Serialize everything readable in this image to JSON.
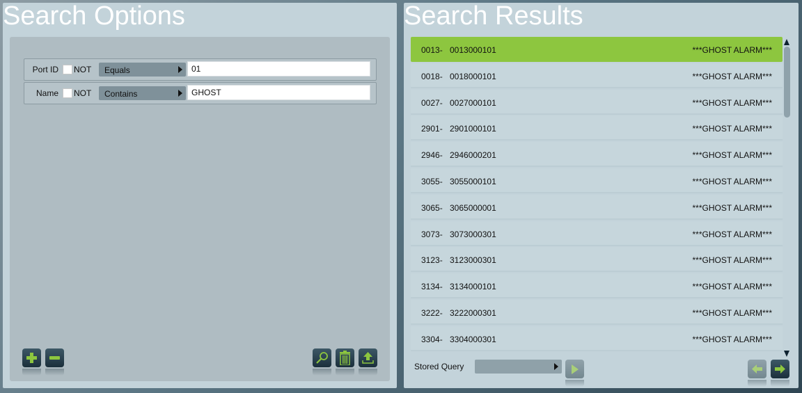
{
  "search_options": {
    "title": "Search Options",
    "criteria": [
      {
        "field": "Port ID",
        "not_label": "NOT",
        "not_checked": false,
        "operator": "Equals",
        "value": "01"
      },
      {
        "field": "Name",
        "not_label": "NOT",
        "not_checked": false,
        "operator": "Contains",
        "value": "GHOST"
      }
    ],
    "buttons": {
      "add": "add-criterion",
      "remove": "remove-criterion",
      "search": "search",
      "delete": "delete",
      "upload": "upload"
    }
  },
  "search_results": {
    "title": "Search Results",
    "selected_index": 0,
    "rows": [
      {
        "prefix": "0013-",
        "id": "0013000101",
        "name": "***GHOST ALARM***"
      },
      {
        "prefix": "0018-",
        "id": "0018000101",
        "name": "***GHOST ALARM***"
      },
      {
        "prefix": "0027-",
        "id": "0027000101",
        "name": "***GHOST ALARM***"
      },
      {
        "prefix": "2901-",
        "id": "2901000101",
        "name": "***GHOST ALARM***"
      },
      {
        "prefix": "2946-",
        "id": "2946000201",
        "name": "***GHOST ALARM***"
      },
      {
        "prefix": "3055-",
        "id": "3055000101",
        "name": "***GHOST ALARM***"
      },
      {
        "prefix": "3065-",
        "id": "3065000001",
        "name": "***GHOST ALARM***"
      },
      {
        "prefix": "3073-",
        "id": "3073000301",
        "name": "***GHOST ALARM***"
      },
      {
        "prefix": "3123-",
        "id": "3123000301",
        "name": "***GHOST ALARM***"
      },
      {
        "prefix": "3134-",
        "id": "3134000101",
        "name": "***GHOST ALARM***"
      },
      {
        "prefix": "3222-",
        "id": "3222000301",
        "name": "***GHOST ALARM***"
      },
      {
        "prefix": "3304-",
        "id": "3304000301",
        "name": "***GHOST ALARM***"
      }
    ],
    "stored_query_label": "Stored Query",
    "stored_query_value": ""
  },
  "colors": {
    "selected_row": "#8dc63f",
    "icon_accent": "#8dc63f"
  }
}
